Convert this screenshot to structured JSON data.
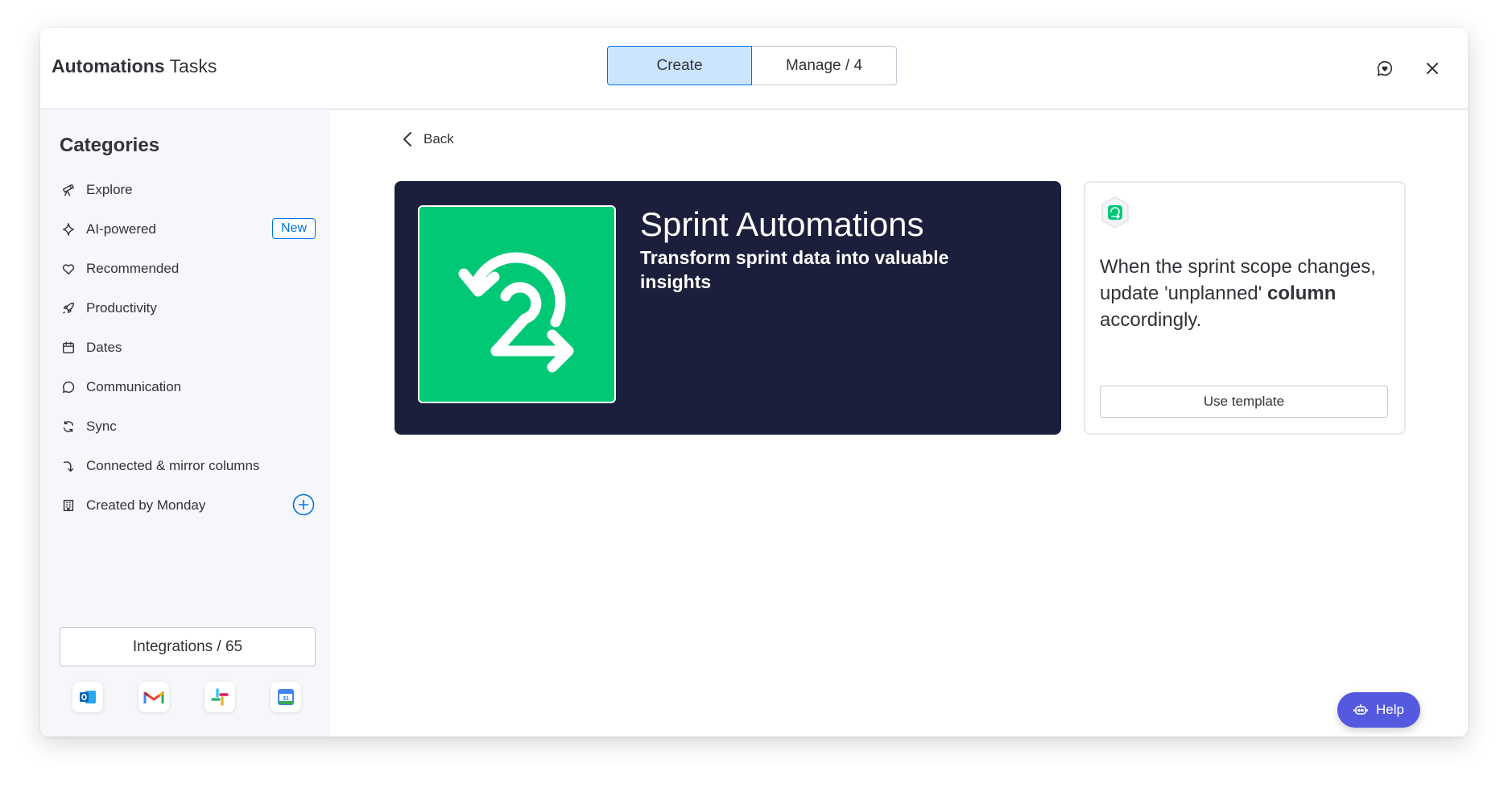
{
  "header": {
    "title_bold": "Automations",
    "title_rest": " Tasks",
    "tabs": [
      {
        "label": "Create",
        "active": true
      },
      {
        "label": "Manage / 4",
        "active": false
      }
    ],
    "icons": [
      "feedback-heart-icon",
      "close-icon"
    ]
  },
  "sidebar": {
    "heading": "Categories",
    "items": [
      {
        "label": "Explore",
        "icon": "telescope-icon"
      },
      {
        "label": "AI-powered",
        "icon": "sparkle-icon",
        "badge": "New"
      },
      {
        "label": "Recommended",
        "icon": "heart-icon"
      },
      {
        "label": "Productivity",
        "icon": "rocket-icon"
      },
      {
        "label": "Dates",
        "icon": "calendar-icon"
      },
      {
        "label": "Communication",
        "icon": "chat-bubble-icon"
      },
      {
        "label": "Sync",
        "icon": "sync-icon"
      },
      {
        "label": "Connected & mirror columns",
        "icon": "connect-arrow-icon"
      },
      {
        "label": "Created by Monday",
        "icon": "building-icon"
      }
    ],
    "integrations_label": "Integrations / 65",
    "apps": [
      "outlook-icon",
      "gmail-icon",
      "slack-icon",
      "google-calendar-icon"
    ]
  },
  "main": {
    "back_label": "Back",
    "banner": {
      "title": "Sprint Automations",
      "subtitle": "Transform sprint data into valuable insights"
    },
    "card": {
      "text_before": "When the sprint scope changes, update 'unplanned' ",
      "text_bold": "column",
      "text_after": " accordingly.",
      "button_label": "Use template"
    },
    "help_label": "Help"
  },
  "colors": {
    "accent": "#0073ea",
    "banner_bg": "#1c1f3b",
    "sprint_green": "#00c875",
    "help_purple": "#5559df",
    "sidebar_bg": "#f6f7fb"
  }
}
